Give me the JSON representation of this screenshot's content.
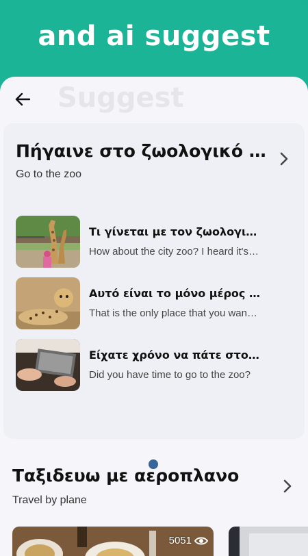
{
  "banner": {
    "title": "and ai suggest"
  },
  "header": {
    "title": "Suggest"
  },
  "card1": {
    "title": "Πήγαινε στο ζωολογικό κήπο",
    "subtitle": "Go to the zoo",
    "items": [
      {
        "title": "Τι γίνεται με τον ζωολογικό κήπο της πόλης;",
        "subtitle": "How about the city zoo? I heard it's great",
        "image": "giraffe-photo"
      },
      {
        "title": "Αυτό είναι το μόνο μέρος που θέλω να πάω",
        "subtitle": "That is the only place that you want to go",
        "image": "cheetah-photo"
      },
      {
        "title": "Είχατε χρόνο να πάτε στο ζωολογικό κήπο;",
        "subtitle": "Did you have time to go to the zoo?",
        "image": "hands-photo"
      }
    ]
  },
  "card2": {
    "title": "Ταξιδευω με αεροπλανο",
    "subtitle": "Travel by plane",
    "views": "5051"
  },
  "colors": {
    "accent": "#1cb497",
    "panel": "#f6f6fa",
    "card": "#eff0f5",
    "dot": "#35679a"
  }
}
